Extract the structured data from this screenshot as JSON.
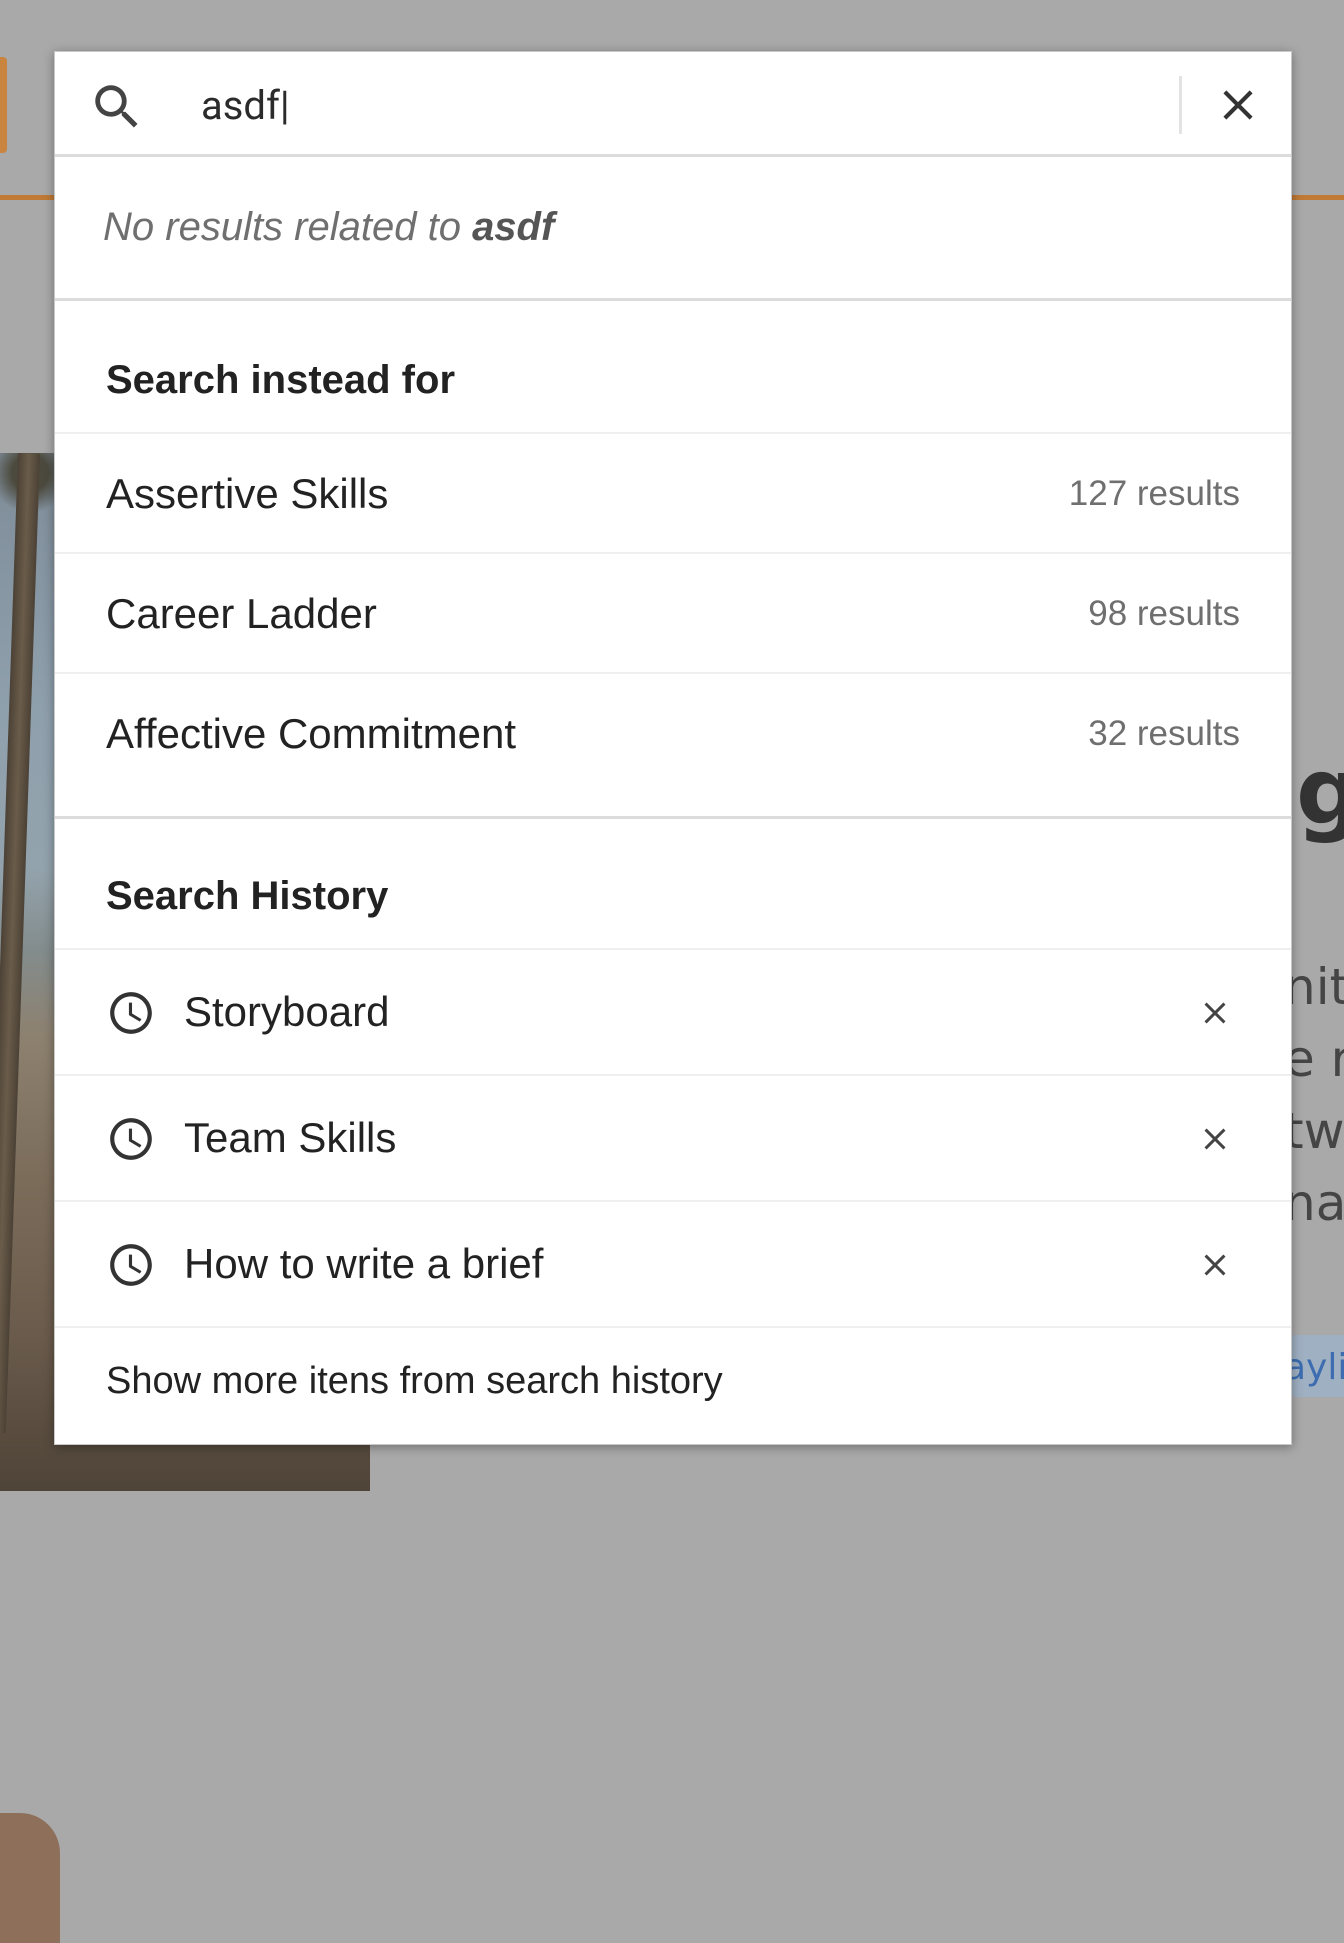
{
  "search": {
    "query": "asdf|",
    "no_results_prefix": "No results related to ",
    "no_results_term": "asdf"
  },
  "suggestions": {
    "title": "Search instead for",
    "items": [
      {
        "label": "Assertive Skills",
        "count": "127 results"
      },
      {
        "label": "Career Ladder",
        "count": "98 results"
      },
      {
        "label": "Affective Commitment",
        "count": "32 results"
      }
    ]
  },
  "history": {
    "title": "Search History",
    "items": [
      {
        "label": "Storyboard"
      },
      {
        "label": "Team Skills"
      },
      {
        "label": "How to write a brief"
      }
    ],
    "show_more": "Show more itens from search history"
  },
  "background": {
    "heading_fragment": "g",
    "para_lines": [
      "nit",
      "e re",
      "tw",
      "nas"
    ],
    "tag_fragment": "aylis"
  },
  "icons": {
    "search": "search-icon",
    "clear": "close-icon",
    "history": "clock-icon",
    "remove": "close-icon"
  },
  "colors": {
    "accent_orange": "#c07a35",
    "overlay": "#a9a9a9",
    "panel": "#ffffff"
  }
}
